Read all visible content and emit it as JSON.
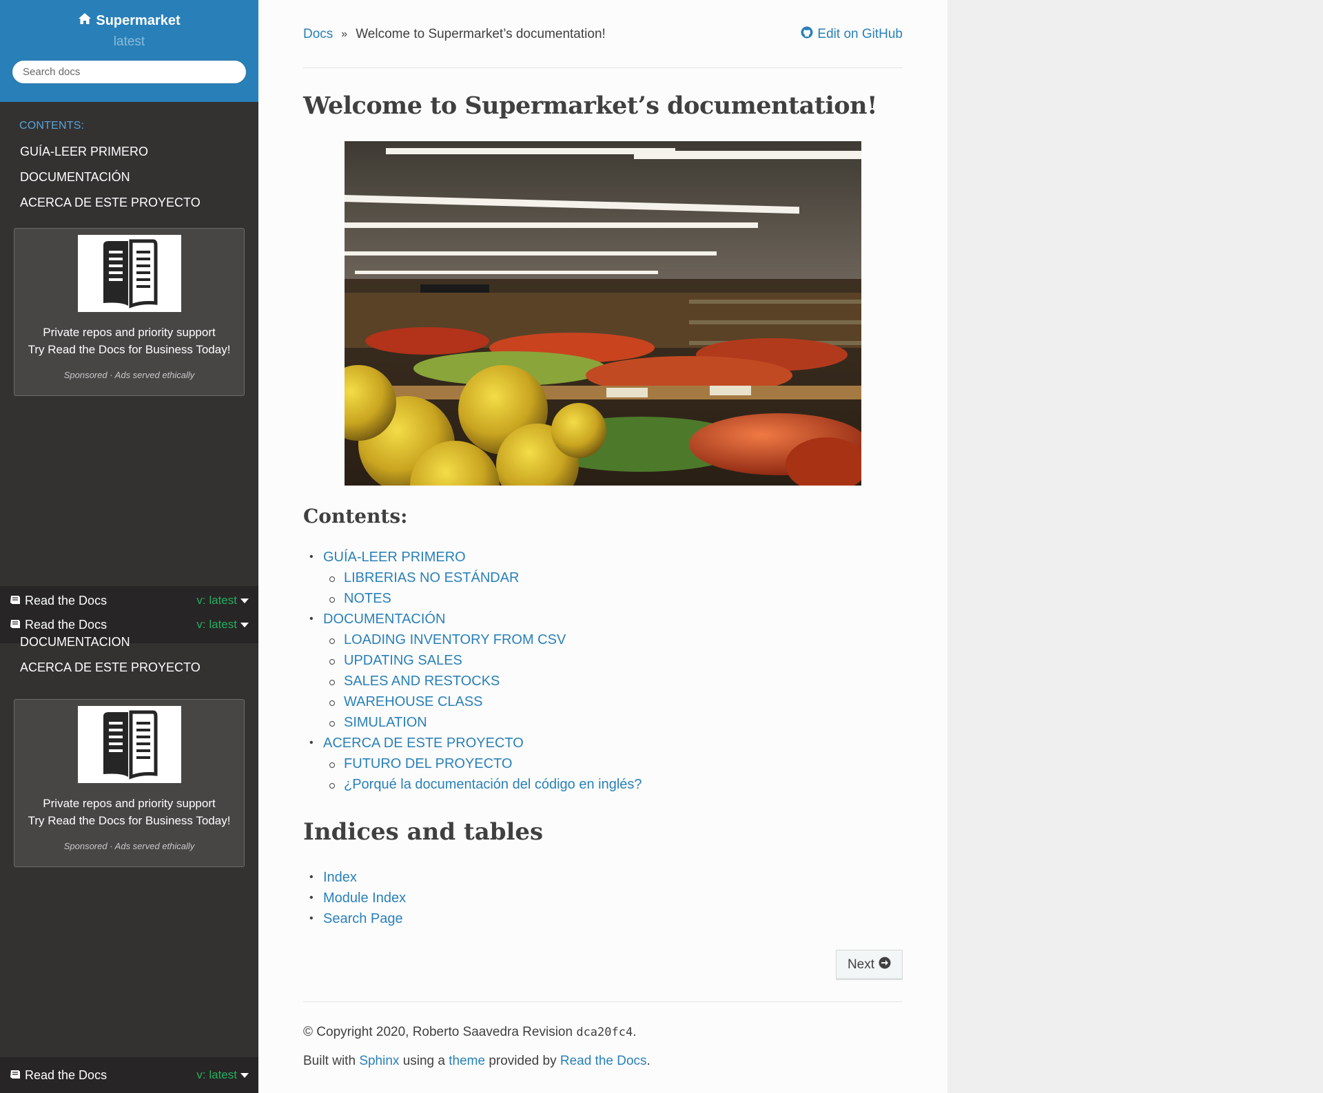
{
  "sidebar": {
    "brand": "Supermarket",
    "version": "latest",
    "search_placeholder": "Search docs",
    "caption": "CONTENTS:",
    "items": [
      "GUÍA-LEER PRIMERO",
      "DOCUMENTACIÓN",
      "ACERCA DE ESTE PROYECTO"
    ],
    "ghost_items": [
      "DOCUMENTACION",
      "ACERCA DE ESTE PROYECTO"
    ],
    "ad": {
      "line1": "Private repos and priority support",
      "line2": "Try Read the Docs for Business Today!",
      "sponsor": "Sponsored · Ads served ethically"
    },
    "rtd": {
      "label": "Read the Docs",
      "version": "v: latest"
    }
  },
  "breadcrumb": {
    "root": "Docs",
    "separator": "»",
    "current": "Welcome to Supermarket’s documentation!",
    "edit": "Edit on GitHub"
  },
  "main": {
    "title": "Welcome to Supermarket’s documentation!",
    "contents_heading": "Contents:",
    "toc": [
      {
        "level": 1,
        "text": "GUÍA-LEER PRIMERO"
      },
      {
        "level": 2,
        "text": "LIBRERIAS NO ESTÁNDAR"
      },
      {
        "level": 2,
        "text": "NOTES"
      },
      {
        "level": 1,
        "text": "DOCUMENTACIÓN"
      },
      {
        "level": 2,
        "text": "LOADING INVENTORY FROM CSV"
      },
      {
        "level": 2,
        "text": "UPDATING SALES"
      },
      {
        "level": 2,
        "text": "SALES AND RESTOCKS"
      },
      {
        "level": 2,
        "text": "WAREHOUSE CLASS"
      },
      {
        "level": 2,
        "text": "SIMULATION"
      },
      {
        "level": 1,
        "text": "ACERCA DE ESTE PROYECTO"
      },
      {
        "level": 2,
        "text": "FUTURO DEL PROYECTO"
      },
      {
        "level": 2,
        "text": "¿Porqué la documentación del código en inglés?"
      }
    ],
    "indices_heading": "Indices and tables",
    "indices": [
      "Index",
      "Module Index",
      "Search Page"
    ],
    "next_label": "Next"
  },
  "footer": {
    "copyright": "© Copyright 2020, Roberto Saavedra Revision ",
    "revision": "dca20fc4",
    "revision_end": ".",
    "built_with": "Built with ",
    "sphinx": "Sphinx",
    "using_a": " using a ",
    "theme": "theme",
    "provided_by": " provided by ",
    "rtd": "Read the Docs",
    "end": "."
  },
  "colors": {
    "accent": "#2980b9",
    "sidebar_bg": "#343131",
    "version_green": "#27ae60"
  }
}
